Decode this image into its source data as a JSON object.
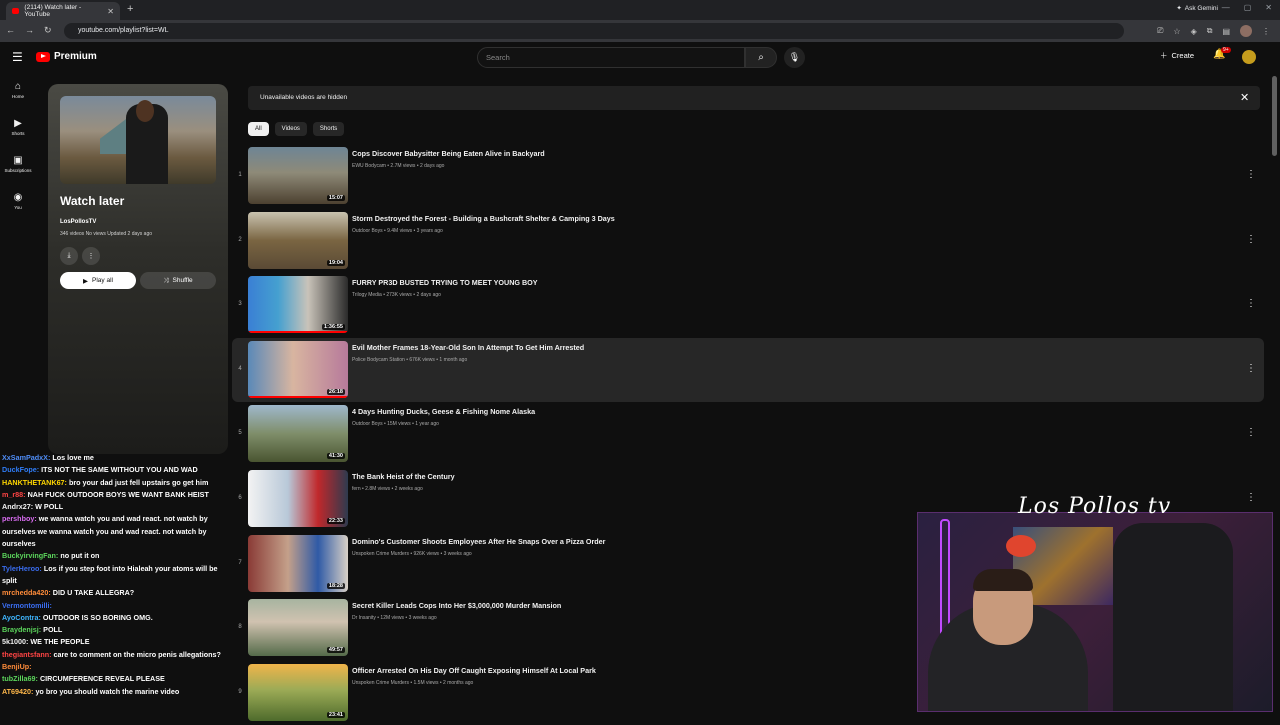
{
  "browser": {
    "tab_title": "(2114) Watch later - YouTube",
    "new_tab": "+",
    "url": "youtube.com/playlist?list=WL",
    "gemini": "Ask Gemini"
  },
  "header": {
    "logo_text": "Premium",
    "search_placeholder": "Search",
    "create_label": "Create",
    "notif_badge": "9+"
  },
  "leftnav": [
    {
      "label": "Home",
      "icon": "home-icon",
      "glyph": "⌂"
    },
    {
      "label": "Shorts",
      "icon": "shorts-icon",
      "glyph": "▶"
    },
    {
      "label": "Subscriptions",
      "icon": "subscriptions-icon",
      "glyph": "▣"
    },
    {
      "label": "You",
      "icon": "you-icon",
      "glyph": "◉"
    }
  ],
  "playlist": {
    "title": "Watch later",
    "owner": "LosPollosTV",
    "stats": "346 videos  No views  Updated 2 days ago",
    "play_all": "Play all",
    "shuffle": "Shuffle"
  },
  "notice": "Unavailable videos are hidden",
  "chips": [
    "All",
    "Videos",
    "Shorts"
  ],
  "videos": [
    {
      "index": "1",
      "title": "Cops Discover Babysitter Being Eaten Alive in Backyard",
      "meta": "EWU Bodycam • 2.7M views • 2 days ago",
      "duration": "15:07",
      "progress": 0
    },
    {
      "index": "2",
      "title": "Storm Destroyed the Forest - Building a Bushcraft Shelter & Camping 3 Days",
      "meta": "Outdoor Boys • 9.4M views • 3 years ago",
      "duration": "19:04",
      "progress": 0
    },
    {
      "index": "3",
      "title": "FURRY PR3D BUSTED TRYING TO MEET YOUNG BOY",
      "meta": "Trilogy Media • 273K views • 2 days ago",
      "duration": "1:36:55",
      "progress": 1
    },
    {
      "index": "4",
      "title": "Evil Mother Frames 18-Year-Old Son In Attempt To Get Him Arrested",
      "meta": "Police Bodycam Station • 676K views • 1 month ago",
      "duration": "26:18",
      "progress": 1
    },
    {
      "index": "5",
      "title": "4 Days Hunting Ducks, Geese & Fishing Nome Alaska",
      "meta": "Outdoor Boys • 15M views • 1 year ago",
      "duration": "41:30",
      "progress": 0
    },
    {
      "index": "6",
      "title": "The Bank Heist of the Century",
      "meta": "fern • 2.8M views • 2 weeks ago",
      "duration": "22:33",
      "progress": 0
    },
    {
      "index": "7",
      "title": "Domino's Customer Shoots Employees After He Snaps Over a Pizza Order",
      "meta": "Unspoken Crime Murders • 926K views • 3 weeks ago",
      "duration": "18:28",
      "progress": 0
    },
    {
      "index": "8",
      "title": "Secret Killer Leads Cops Into Her $3,000,000 Murder Mansion",
      "meta": "Dr Insanity • 12M views • 3 weeks ago",
      "duration": "49:57",
      "progress": 0
    },
    {
      "index": "9",
      "title": "Officer Arrested On His Day Off Caught Exposing Himself At Local Park",
      "meta": "Unspoken Crime Murders • 1.5M views • 2 months ago",
      "duration": "23:41",
      "progress": 0
    }
  ],
  "chat": [
    {
      "user": "XxSamPadxX:",
      "text": "Los love me",
      "color": "#4f8df7"
    },
    {
      "user": "DuckFope:",
      "text": "ITS NOT THE SAME WITHOUT YOU AND WAD",
      "color": "#2f7cf6"
    },
    {
      "user": "HANKTHETANK67:",
      "text": "bro your dad just fell upstairs go get him",
      "color": "#ffd700"
    },
    {
      "user": "m_r88:",
      "text": "NAH FUCK OUTDOOR BOYS WE WANT BANK HEIST",
      "color": "#ff4444"
    },
    {
      "user": "Andrx27:",
      "text": "W POLL",
      "color": "#f0f0f0"
    },
    {
      "user": "pershboy:",
      "text": "we wanna watch you and wad react. not watch by ourselves we wanna watch you and wad react. not watch by ourselves",
      "color": "#d86cf0"
    },
    {
      "user": "BuckyirvingFan:",
      "text": "no put it on",
      "color": "#5cd65c"
    },
    {
      "user": "TylerHeroo:",
      "text": "Los if you step foot into Hialeah your atoms will be split",
      "color": "#3a6df0"
    },
    {
      "user": "mrchedda420:",
      "text": "DID U TAKE ALLEGRA?",
      "color": "#ff8c3a"
    },
    {
      "user": "Vermontomilli:",
      "text": "",
      "color": "#3a6df0"
    },
    {
      "user": "AyoContra:",
      "text": "OUTDOOR IS SO BORING OMG.",
      "color": "#3fb6ff"
    },
    {
      "user": "Braydenjsj:",
      "text": "POLL",
      "color": "#5cd65c"
    },
    {
      "user": "5k1000:",
      "text": "WE THE PEOPLE",
      "color": "#f0f0f0"
    },
    {
      "user": "thegiantsfann:",
      "text": "care to comment on the micro penis allegations?",
      "color": "#ff4444"
    },
    {
      "user": "BenjiUp:",
      "text": "",
      "color": "#ff8c3a"
    },
    {
      "user": "tubZilla69:",
      "text": "CIRCUMFERENCE REVEAL PLEASE",
      "color": "#5cd65c"
    },
    {
      "user": "AT69420:",
      "text": "yo bro you should watch the marine video",
      "color": "#ffb84a"
    }
  ],
  "overlay": {
    "signature": "Los Pollos tv"
  }
}
